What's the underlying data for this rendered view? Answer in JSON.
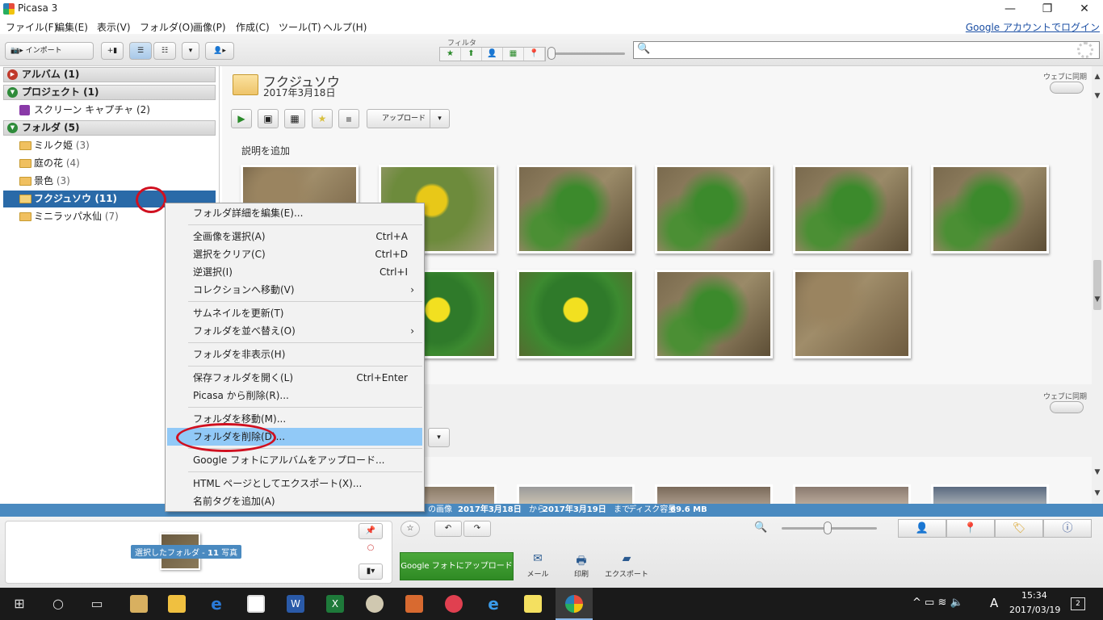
{
  "window": {
    "title": "Picasa 3",
    "login_link": "Google アカウントでログイン"
  },
  "menu": [
    "ファイル(F)",
    "編集(E)",
    "表示(V)",
    "フォルダ(O)",
    "画像(P)",
    "作成(C)",
    "ツール(T)",
    "ヘルプ(H)"
  ],
  "toolbar": {
    "import_label": "インポート",
    "filter_label": "フィルタ"
  },
  "sidebar": {
    "sections": [
      {
        "label": "アルバム (1)"
      },
      {
        "label": "プロジェクト (1)"
      },
      {
        "label": "フォルダ (5)"
      }
    ],
    "project_items": [
      {
        "label": "スクリーン キャプチャ",
        "count": "(2)"
      }
    ],
    "folders": [
      {
        "label": "ミルク姫",
        "count": "(3)"
      },
      {
        "label": "庭の花",
        "count": "(4)"
      },
      {
        "label": "景色",
        "count": "(3)"
      },
      {
        "label": "フクジュソウ",
        "count": "(11)"
      },
      {
        "label": "ミニラッパ水仙",
        "count": "(7)"
      }
    ]
  },
  "album": {
    "title": "フクジュソウ",
    "date": "2017年3月18日",
    "upload_label": "アップロード",
    "caption": "説明を追加",
    "web_sync": "ウェブに同期"
  },
  "album2": {
    "web_sync": "ウェブに同期"
  },
  "context_menu": [
    {
      "label": "フォルダ詳細を編集(E)...",
      "shortcut": ""
    },
    {
      "label": "全画像を選択(A)",
      "shortcut": "Ctrl+A"
    },
    {
      "label": "選択をクリア(C)",
      "shortcut": "Ctrl+D"
    },
    {
      "label": "逆選択(I)",
      "shortcut": "Ctrl+I"
    },
    {
      "label": "コレクションへ移動(V)",
      "shortcut": "›"
    },
    {
      "label": "サムネイルを更新(T)",
      "shortcut": ""
    },
    {
      "label": "フォルダを並べ替え(O)",
      "shortcut": "›"
    },
    {
      "label": "フォルダを非表示(H)",
      "shortcut": ""
    },
    {
      "label": "保存フォルダを開く(L)",
      "shortcut": "Ctrl+Enter"
    },
    {
      "label": "Picasa から削除(R)...",
      "shortcut": ""
    },
    {
      "label": "フォルダを移動(M)...",
      "shortcut": ""
    },
    {
      "label": "フォルダを削除(D)...",
      "shortcut": ""
    },
    {
      "label": "Google フォトにアルバムをアップロード...",
      "shortcut": ""
    },
    {
      "label": "HTML ページとしてエクスポート(X)...",
      "shortcut": ""
    },
    {
      "label": "名前タグを追加(A)",
      "shortcut": ""
    }
  ],
  "status": {
    "images": "の画像",
    "from_date": "2017年3月18日",
    "from_label": "から",
    "to_date": "2017年3月19日",
    "to_label": "まで",
    "disk": "ディスク容量",
    "disk_size": "69.6 MB"
  },
  "tray": {
    "label": "選択したフォルダ -",
    "count": "11",
    "unit": "写真"
  },
  "actions": {
    "gupload": "Google フォトにアップロード",
    "mail": "メール",
    "print": "印刷",
    "export": "エクスポート"
  },
  "clock": {
    "time": "15:34",
    "date": "2017/03/19",
    "ime": "A",
    "notif": "2"
  }
}
